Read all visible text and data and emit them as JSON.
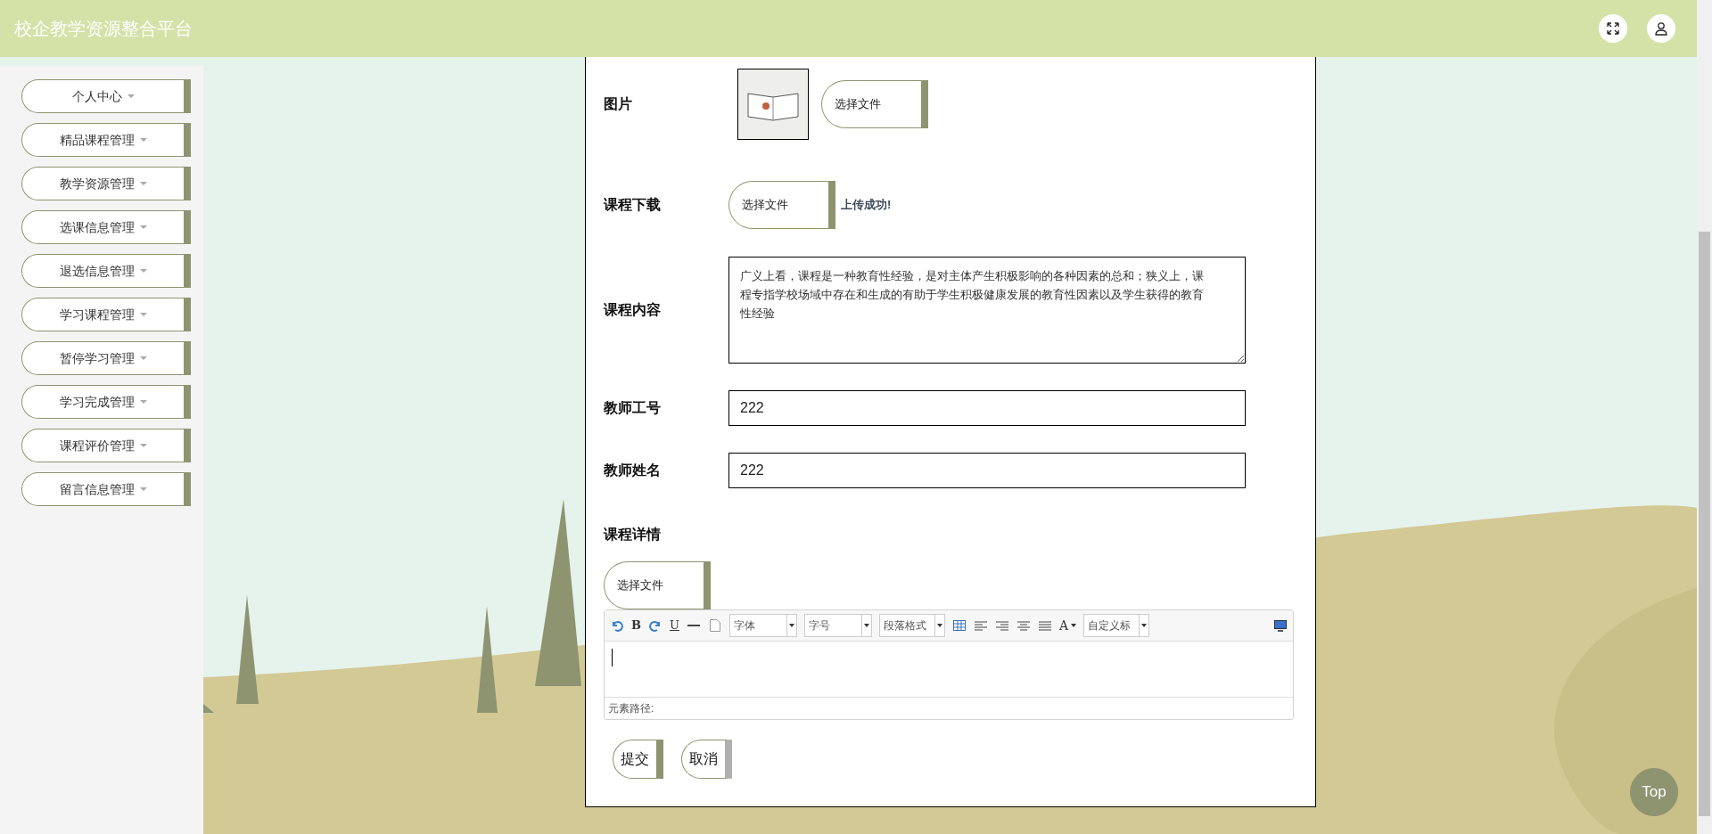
{
  "header": {
    "title": "校企教学资源整合平台"
  },
  "sidebar": {
    "items": [
      {
        "label": "个人中心"
      },
      {
        "label": "精品课程管理"
      },
      {
        "label": "教学资源管理"
      },
      {
        "label": "选课信息管理"
      },
      {
        "label": "退选信息管理"
      },
      {
        "label": "学习课程管理"
      },
      {
        "label": "暂停学习管理"
      },
      {
        "label": "学习完成管理"
      },
      {
        "label": "课程评价管理"
      },
      {
        "label": "留言信息管理"
      }
    ]
  },
  "form": {
    "fields": [
      {
        "kind": "image",
        "label": "图片",
        "button": "选择文件"
      },
      {
        "kind": "file",
        "label": "课程下载",
        "button": "选择文件",
        "status": "上传成功!"
      },
      {
        "kind": "textarea",
        "label": "课程内容",
        "value": "广义上看，课程是一种教育性经验，是对主体产生积极影响的各种因素的总和；狭义上，课程专指学校场域中存在和生成的有助于学生积极健康发展的教育性因素以及学生获得的教育性经验"
      },
      {
        "kind": "input",
        "label": "教师工号",
        "value": "222"
      },
      {
        "kind": "input",
        "label": "教师姓名",
        "value": "222"
      },
      {
        "kind": "editor",
        "label": "课程详情",
        "button": "选择文件",
        "toolbar": {
          "bold": "B",
          "underline": "U",
          "font": "字体",
          "size": "字号",
          "paragraph": "段落格式",
          "font_style_menu": "A",
          "heading": "自定义标"
        },
        "path_label": "元素路径:"
      }
    ],
    "actions": [
      {
        "kind": "submit",
        "label": "提交"
      },
      {
        "kind": "cancel",
        "label": "取消"
      }
    ]
  },
  "back_to_top": "Top"
}
